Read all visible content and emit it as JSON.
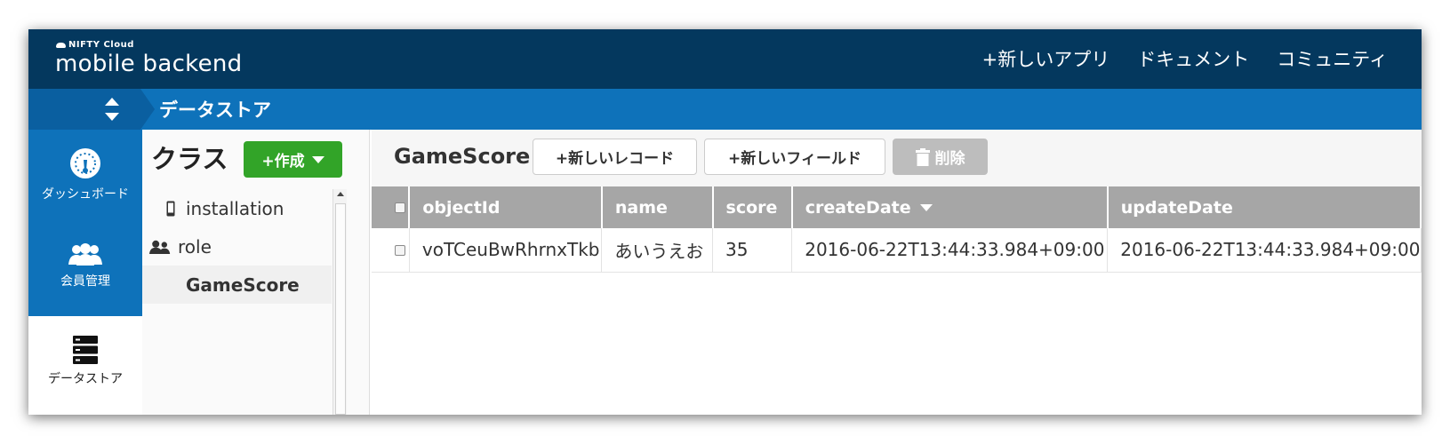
{
  "header": {
    "logo_small": "NIFTY Cloud",
    "logo_main": "mobile backend",
    "nav": [
      "+新しいアプリ",
      "ドキュメント",
      "コミュニティ"
    ]
  },
  "subbar": {
    "title": "データストア"
  },
  "leftnav": [
    {
      "label": "ダッシュボード",
      "icon": "dashboard-icon"
    },
    {
      "label": "会員管理",
      "icon": "users-icon"
    },
    {
      "label": "データストア",
      "icon": "datastore-icon",
      "active": true
    }
  ],
  "class_panel": {
    "title": "クラス",
    "create_label": "+作成",
    "classes": [
      {
        "name": "installation",
        "icon": "mobile-icon"
      },
      {
        "name": "role",
        "icon": "role-icon"
      },
      {
        "name": "GameScore",
        "icon": "",
        "selected": true
      }
    ]
  },
  "main": {
    "title": "GameScore",
    "new_record_label": "+新しいレコード",
    "new_field_label": "+新しいフィールド",
    "delete_label": "削除",
    "columns": [
      "objectId",
      "name",
      "score",
      "createDate",
      "updateDate"
    ],
    "rows": [
      [
        "voTCeuBwRhrnxTkb",
        "あいうえお",
        "35",
        "2016-06-22T13:44:33.984+09:00",
        "2016-06-22T13:44:33.984+09:00"
      ]
    ]
  },
  "colors": {
    "header_bg": "#04385e",
    "subbar_bg": "#0e72ba",
    "create_green": "#32a428",
    "table_header": "#a6a6a6"
  }
}
